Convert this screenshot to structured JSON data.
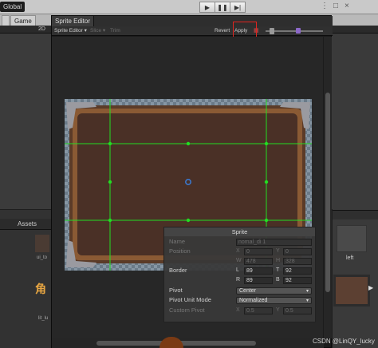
{
  "app": {
    "global_label": "Global",
    "play_icons": [
      "play-icon",
      "pause-icon",
      "step-icon"
    ],
    "window_controls": [
      "⋮",
      "□",
      "×"
    ]
  },
  "scene_tabs": {
    "game_label": "Game",
    "mode_label": "2D"
  },
  "sprite_editor": {
    "window_title": "Sprite Editor",
    "toolbar": {
      "mode_dropdown": "Sprite Editor ▾",
      "slice": "Slice ▾",
      "trim": "Trim",
      "revert": "Revert",
      "apply": "Apply"
    },
    "highlight_color": "#e0241f"
  },
  "sprite_panel": {
    "header": "Sprite",
    "name_label": "Name",
    "name_value": "nomal_di 1",
    "position_label": "Position",
    "pos_x_label": "X",
    "pos_x": "0",
    "pos_y_label": "Y",
    "pos_y": "0",
    "pos_w_label": "W",
    "pos_w": "478",
    "pos_h_label": "H",
    "pos_h": "328",
    "border_label": "Border",
    "border_l_label": "L",
    "border_l": "89",
    "border_t_label": "T",
    "border_t": "92",
    "border_r_label": "R",
    "border_r": "89",
    "border_b_label": "B",
    "border_b": "92",
    "pivot_label": "Pivot",
    "pivot_value": "Center",
    "pivot_unit_label": "Pivot Unit Mode",
    "pivot_unit_value": "Normalized",
    "custom_pivot_label": "Custom Pivot",
    "cp_x_label": "X",
    "cp_x": "0.5",
    "cp_y_label": "Y",
    "cp_y": "0.5"
  },
  "project": {
    "assets_label": "Assets",
    "item1_label": "ui_to",
    "item2_label": "lit_lu",
    "item2_glyph": "角"
  },
  "right_panel": {
    "left_label": "left"
  },
  "colors": {
    "slice_line": "#22dd22",
    "pivot": "#3a7bd5",
    "frame_brown": "#4a3026"
  },
  "watermark": "CSDN @LinQY_lucky"
}
